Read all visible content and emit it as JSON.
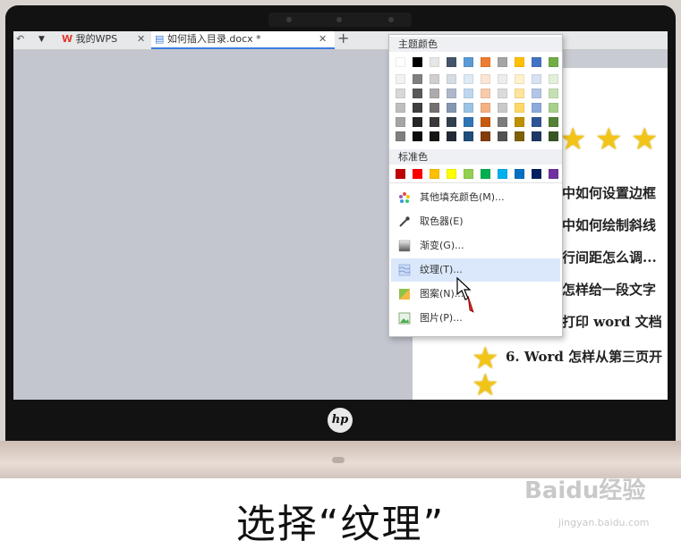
{
  "tabs": [
    {
      "label": "我的WPS",
      "icon": "wps-logo-icon"
    },
    {
      "label": "如何插入目录.docx *",
      "icon": "doc-icon"
    }
  ],
  "popup": {
    "theme_title": "主题颜色",
    "standard_title": "标准色",
    "theme_top": [
      "#ffffff",
      "#000000",
      "#e7e6e6",
      "#44546a",
      "#5b9bd5",
      "#ed7d31",
      "#a5a5a5",
      "#ffc000",
      "#4472c4",
      "#70ad47"
    ],
    "theme_shades": [
      [
        "#f2f2f2",
        "#7f7f7f",
        "#d0cece",
        "#d6dce4",
        "#deebf6",
        "#fbe5d5",
        "#ededed",
        "#fff2cc",
        "#d9e2f3",
        "#e2efd9"
      ],
      [
        "#d8d8d8",
        "#595959",
        "#aeabab",
        "#adb9ca",
        "#bdd7ee",
        "#f8cbad",
        "#dbdbdb",
        "#fee599",
        "#b4c6e7",
        "#c5e0b3"
      ],
      [
        "#bfbfbf",
        "#3f3f3f",
        "#757070",
        "#8496b0",
        "#9cc3e5",
        "#f4b183",
        "#c9c9c9",
        "#ffd965",
        "#8eaadb",
        "#a8d08d"
      ],
      [
        "#a5a5a5",
        "#262626",
        "#3a3838",
        "#323f4f",
        "#2e75b5",
        "#c55a11",
        "#7b7b7b",
        "#bf9000",
        "#2f5496",
        "#538135"
      ],
      [
        "#7f7f7f",
        "#0c0c0c",
        "#171616",
        "#222a35",
        "#1e4e79",
        "#833c0b",
        "#525252",
        "#7f6000",
        "#1f3864",
        "#375623"
      ]
    ],
    "standard": [
      "#c00000",
      "#ff0000",
      "#ffc000",
      "#ffff00",
      "#92d050",
      "#00b050",
      "#00b0f0",
      "#0070c0",
      "#002060",
      "#7030a0"
    ],
    "menu": [
      {
        "label": "其他填充颜色(M)...",
        "icon": "palette-icon"
      },
      {
        "label": "取色器(E)",
        "icon": "eyedropper-icon"
      },
      {
        "label": "渐变(G)...",
        "icon": "gradient-icon"
      },
      {
        "label": "纹理(T)...",
        "icon": "texture-icon"
      },
      {
        "label": "图案(N)...",
        "icon": "pattern-icon"
      },
      {
        "label": "图片(P)...",
        "icon": "picture-icon"
      }
    ]
  },
  "document": {
    "lines": [
      "中如何设置边框",
      "中如何绘制斜线",
      "行间距怎么调...",
      "怎样给一段文字",
      "打印 word 文档",
      "6. Word 怎样从第三页开"
    ]
  },
  "brand": "hp",
  "caption": "选择“纹理”",
  "watermark": "Baidu经验",
  "watermark_url": "jingyan.baidu.com"
}
